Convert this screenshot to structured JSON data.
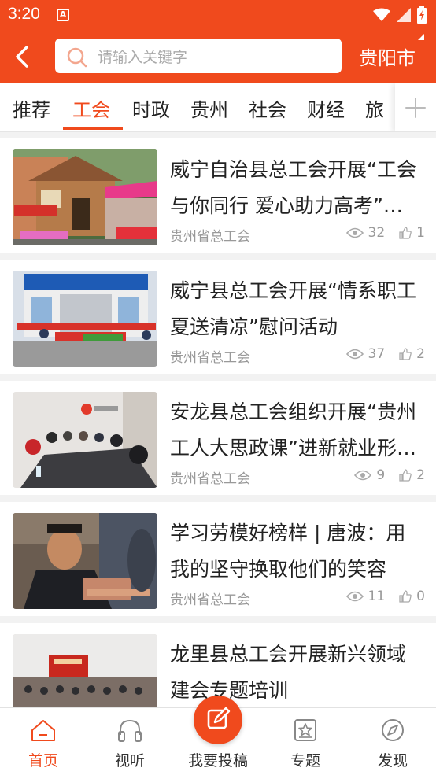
{
  "status_bar": {
    "time": "3:20",
    "notification_glyph": "A"
  },
  "header": {
    "search_placeholder": "请输入关键字",
    "city": "贵阳市"
  },
  "tabs": [
    {
      "label": "推荐"
    },
    {
      "label": "工会",
      "active": true
    },
    {
      "label": "时政"
    },
    {
      "label": "贵州"
    },
    {
      "label": "社会"
    },
    {
      "label": "财经"
    },
    {
      "label": "旅"
    }
  ],
  "articles": [
    {
      "title": "威宁自治县总工会开展“工会与你同行 爱心助力高考”活动",
      "source": "贵州省总工会",
      "views": "32",
      "likes": "1"
    },
    {
      "title": "威宁县总工会开展“情系职工 夏送清凉”慰问活动",
      "source": "贵州省总工会",
      "views": "37",
      "likes": "2"
    },
    {
      "title": "安龙县总工会组织开展“贵州工人大思政课”进新就业形态劳动者活动",
      "source": "贵州省总工会",
      "views": "9",
      "likes": "2"
    },
    {
      "title": "学习劳模好榜样 | 唐波：用我的坚守换取他们的笑容",
      "source": "贵州省总工会",
      "views": "11",
      "likes": "0"
    },
    {
      "title": "龙里县总工会开展新兴领域建会专题培训",
      "source": "",
      "views": "",
      "likes": ""
    }
  ],
  "bottom_nav": [
    {
      "label": "首页",
      "icon": "home-icon",
      "active": true
    },
    {
      "label": "视听",
      "icon": "headphones-icon"
    },
    {
      "label": "我要投稿",
      "icon": "edit-icon"
    },
    {
      "label": "专题",
      "icon": "star-card-icon"
    },
    {
      "label": "发现",
      "icon": "compass-icon"
    }
  ],
  "colors": {
    "accent": "#f04a1d",
    "text": "#222222",
    "muted": "#999999"
  }
}
